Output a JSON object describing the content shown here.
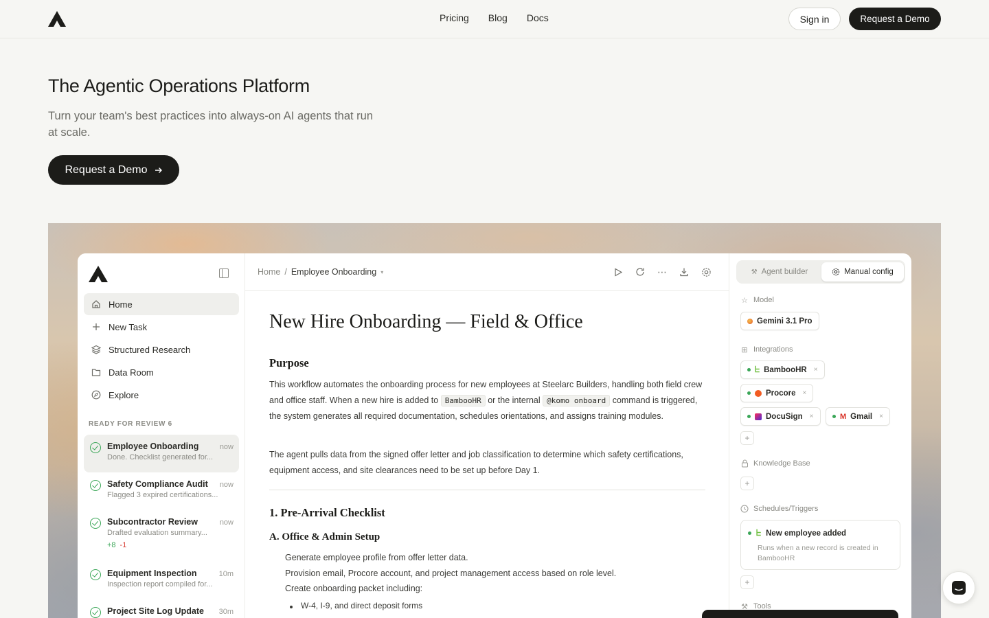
{
  "nav": {
    "links": [
      "Pricing",
      "Blog",
      "Docs"
    ],
    "sign_in": "Sign in",
    "request_demo": "Request a Demo"
  },
  "hero": {
    "title": "The Agentic Operations Platform",
    "subtitle": "Turn your team's best practices into always-on AI agents that run at scale.",
    "cta": "Request a Demo",
    "cta_icon": "arrow-right-icon"
  },
  "app": {
    "sidebar": {
      "items": [
        {
          "label": "Home",
          "icon": "home-icon",
          "active": true
        },
        {
          "label": "New Task",
          "icon": "plus-icon"
        },
        {
          "label": "Structured Research",
          "icon": "layers-icon"
        },
        {
          "label": "Data Room",
          "icon": "folder-icon"
        },
        {
          "label": "Explore",
          "icon": "compass-icon"
        }
      ],
      "section_label": "READY FOR REVIEW 6",
      "tasks": [
        {
          "title": "Employee Onboarding",
          "desc": "Done. Checklist generated for...",
          "time": "now",
          "active": true
        },
        {
          "title": "Safety Compliance Audit",
          "desc": "Flagged 3 expired certifications...",
          "time": "now"
        },
        {
          "title": "Subcontractor Review",
          "desc": "Drafted evaluation summary...",
          "time": "now",
          "plus": "+8",
          "minus": "-1"
        },
        {
          "title": "Equipment Inspection",
          "desc": "Inspection report compiled for...",
          "time": "10m"
        },
        {
          "title": "Project Site Log Update",
          "desc": "",
          "time": "30m"
        }
      ]
    },
    "breadcrumb": {
      "home": "Home",
      "separator": "/",
      "current": "Employee Onboarding"
    },
    "doc": {
      "title": "New Hire Onboarding — Field & Office",
      "purpose_heading": "Purpose",
      "p1_a": "This workflow automates the onboarding process for new employees at Steelarc Builders, handling both field crew and office staff. When a new hire is added to",
      "p1_code1": "BambooHR",
      "p1_b": "or the internal",
      "p1_code2": "@komo onboard",
      "p1_c": "command is triggered, the system generates all required documentation, schedules orientations, and assigns training modules.",
      "p2": "The agent pulls data from the signed offer letter and job classification to determine which safety certifications, equipment access, and site clearances need to be set up before Day 1.",
      "h_checklist": "1. Pre-Arrival Checklist",
      "h_office": "A. Office & Admin Setup",
      "lines": [
        "Generate employee profile from offer letter data.",
        "Provision email, Procore account, and project management access based on role level.",
        "Create onboarding packet including:"
      ],
      "bullets": [
        "W-4, I-9, and direct deposit forms"
      ]
    },
    "panel": {
      "tab_agent": "Agent builder",
      "tab_manual": "Manual config",
      "model_label": "Model",
      "model": "Gemini 3.1 Pro",
      "integrations_label": "Integrations",
      "integrations": [
        "BambooHR",
        "Procore",
        "DocuSign",
        "Gmail"
      ],
      "knowledge_label": "Knowledge Base",
      "schedules_label": "Schedules/Triggers",
      "trigger_title": "New employee added",
      "trigger_desc": "Runs when a new record is created in BambooHR",
      "tools_label": "Tools"
    }
  }
}
